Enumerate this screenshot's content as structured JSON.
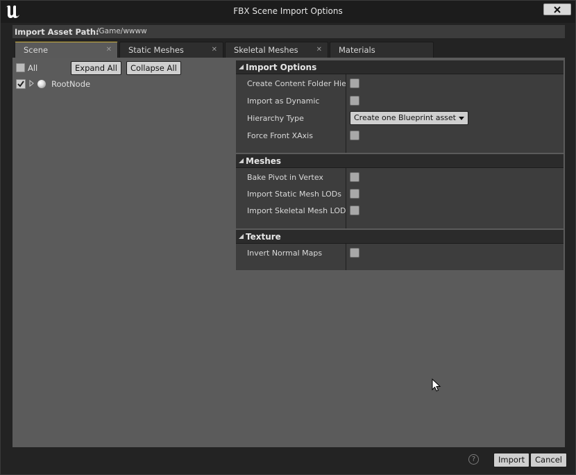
{
  "window": {
    "title": "FBX Scene Import Options",
    "close_icon": "close-icon"
  },
  "path_bar": {
    "label": "Import Asset Path:",
    "value": "/Game/wwww"
  },
  "tabs": [
    {
      "label": "Scene",
      "active": true
    },
    {
      "label": "Static Meshes",
      "active": false
    },
    {
      "label": "Skeletal Meshes",
      "active": false
    },
    {
      "label": "Materials",
      "active": false
    }
  ],
  "scene_tree": {
    "all_label": "All",
    "all_checked": false,
    "expand_all_label": "Expand All",
    "collapse_all_label": "Collapse All",
    "root_label": "RootNode",
    "root_checked": true
  },
  "sections": {
    "import_options": {
      "title": "Import Options",
      "rows": [
        {
          "label": "Create Content Folder Hierarchy",
          "checked": false
        },
        {
          "label": "Import as Dynamic",
          "checked": false
        },
        {
          "label": "Hierarchy Type",
          "value": "Create one Blueprint asset"
        },
        {
          "label": "Force Front XAxis",
          "checked": false
        }
      ]
    },
    "meshes": {
      "title": "Meshes",
      "rows": [
        {
          "label": "Bake Pivot in Vertex",
          "checked": false
        },
        {
          "label": "Import Static Mesh LODs",
          "checked": false
        },
        {
          "label": "Import Skeletal Mesh LODs",
          "checked": false
        }
      ]
    },
    "texture": {
      "title": "Texture",
      "rows": [
        {
          "label": "Invert Normal Maps",
          "checked": false
        }
      ]
    }
  },
  "footer": {
    "help_label": "?",
    "import_label": "Import",
    "cancel_label": "Cancel"
  },
  "colors": {
    "accent_tab": "#ccb040",
    "panel_bg": "#5b5b5b",
    "section_bg": "#3d3d3d"
  }
}
